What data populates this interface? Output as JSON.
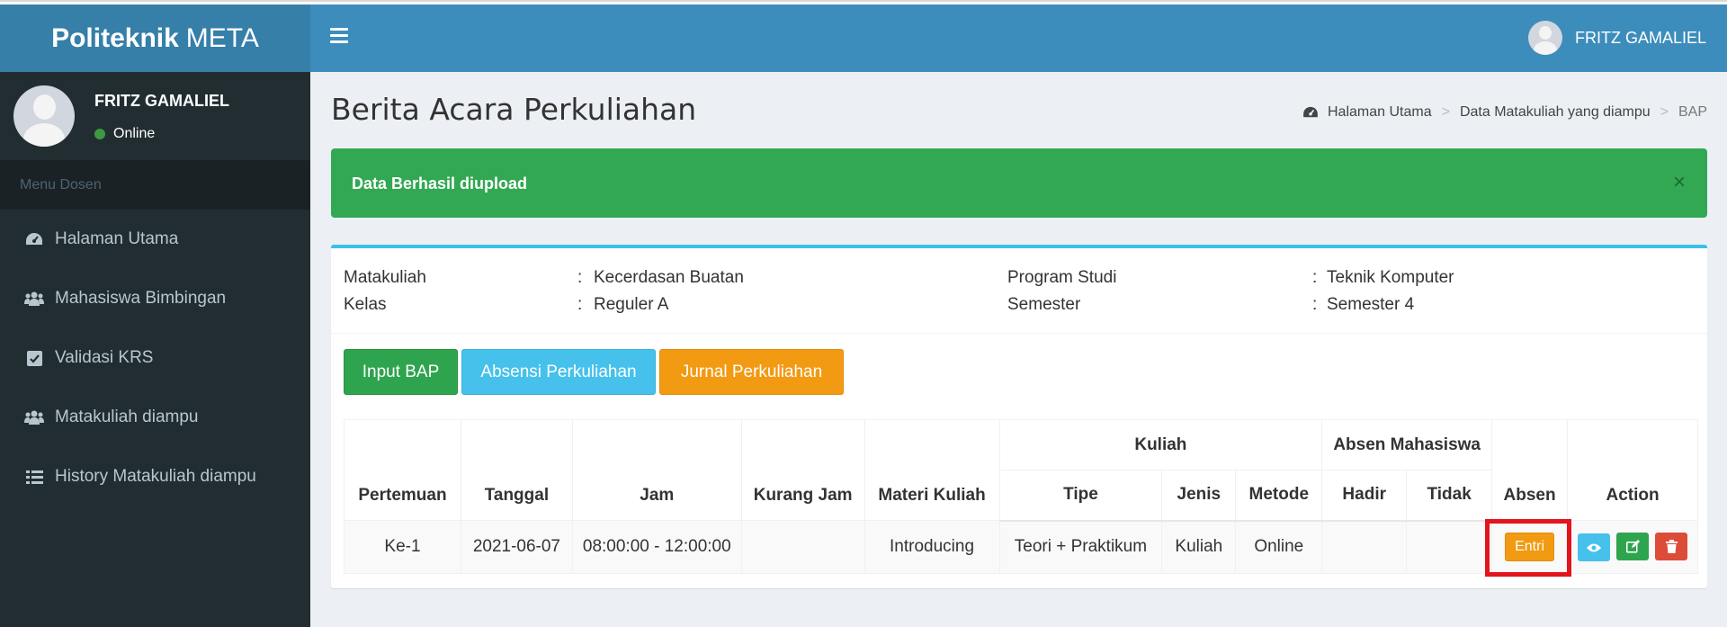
{
  "brand": {
    "bold": "Politeknik",
    "light": "META"
  },
  "navbar": {
    "user_name": "FRITZ GAMALIEL"
  },
  "sidebar": {
    "user_name": "FRITZ GAMALIEL",
    "status": "Online",
    "menu_header": "Menu Dosen",
    "items": [
      {
        "label": "Halaman Utama",
        "icon": "dashboard-icon"
      },
      {
        "label": "Mahasiswa Bimbingan",
        "icon": "users-icon"
      },
      {
        "label": "Validasi KRS",
        "icon": "check-square-icon"
      },
      {
        "label": "Matakuliah diampu",
        "icon": "users-icon"
      },
      {
        "label": "History Matakuliah diampu",
        "icon": "list-icon"
      }
    ]
  },
  "page": {
    "title": "Berita Acara Perkuliahan",
    "breadcrumb": [
      "Halaman Utama",
      "Data Matakuliah yang diampu",
      "BAP"
    ]
  },
  "alert": {
    "message": "Data Berhasil diupload",
    "close": "×"
  },
  "info": {
    "matakuliah_label": "Matakuliah",
    "matakuliah_value": "Kecerdasan Buatan",
    "kelas_label": "Kelas",
    "kelas_value": "Reguler A",
    "prodi_label": "Program Studi",
    "prodi_value": "Teknik Komputer",
    "semester_label": "Semester",
    "semester_value": "Semester 4",
    "colon": ":"
  },
  "buttons": {
    "input_bap": "Input BAP",
    "absensi": "Absensi Perkuliahan",
    "jurnal": "Jurnal Perkuliahan"
  },
  "table": {
    "headers": {
      "pertemuan": "Pertemuan",
      "tanggal": "Tanggal",
      "jam": "Jam",
      "kurang_jam": "Kurang Jam",
      "materi": "Materi Kuliah",
      "kuliah": "Kuliah",
      "tipe": "Tipe",
      "jenis": "Jenis",
      "metode": "Metode",
      "absen_mhs": "Absen Mahasiswa",
      "hadir": "Hadir",
      "tidak": "Tidak",
      "absen": "Absen",
      "action": "Action"
    },
    "rows": [
      {
        "pertemuan": "Ke-1",
        "tanggal": "2021-06-07",
        "jam": "08:00:00 - 12:00:00",
        "kurang_jam": "",
        "materi": "Introducing",
        "tipe": "Teori + Praktikum",
        "jenis": "Kuliah",
        "metode": "Online",
        "hadir": "",
        "tidak": "",
        "absen_button": "Entri"
      }
    ]
  },
  "colors": {
    "header": "#3c8dbc",
    "logo": "#367fa9",
    "sidebar": "#222d32",
    "success": "#33a853",
    "highlight": "#e3141c"
  }
}
